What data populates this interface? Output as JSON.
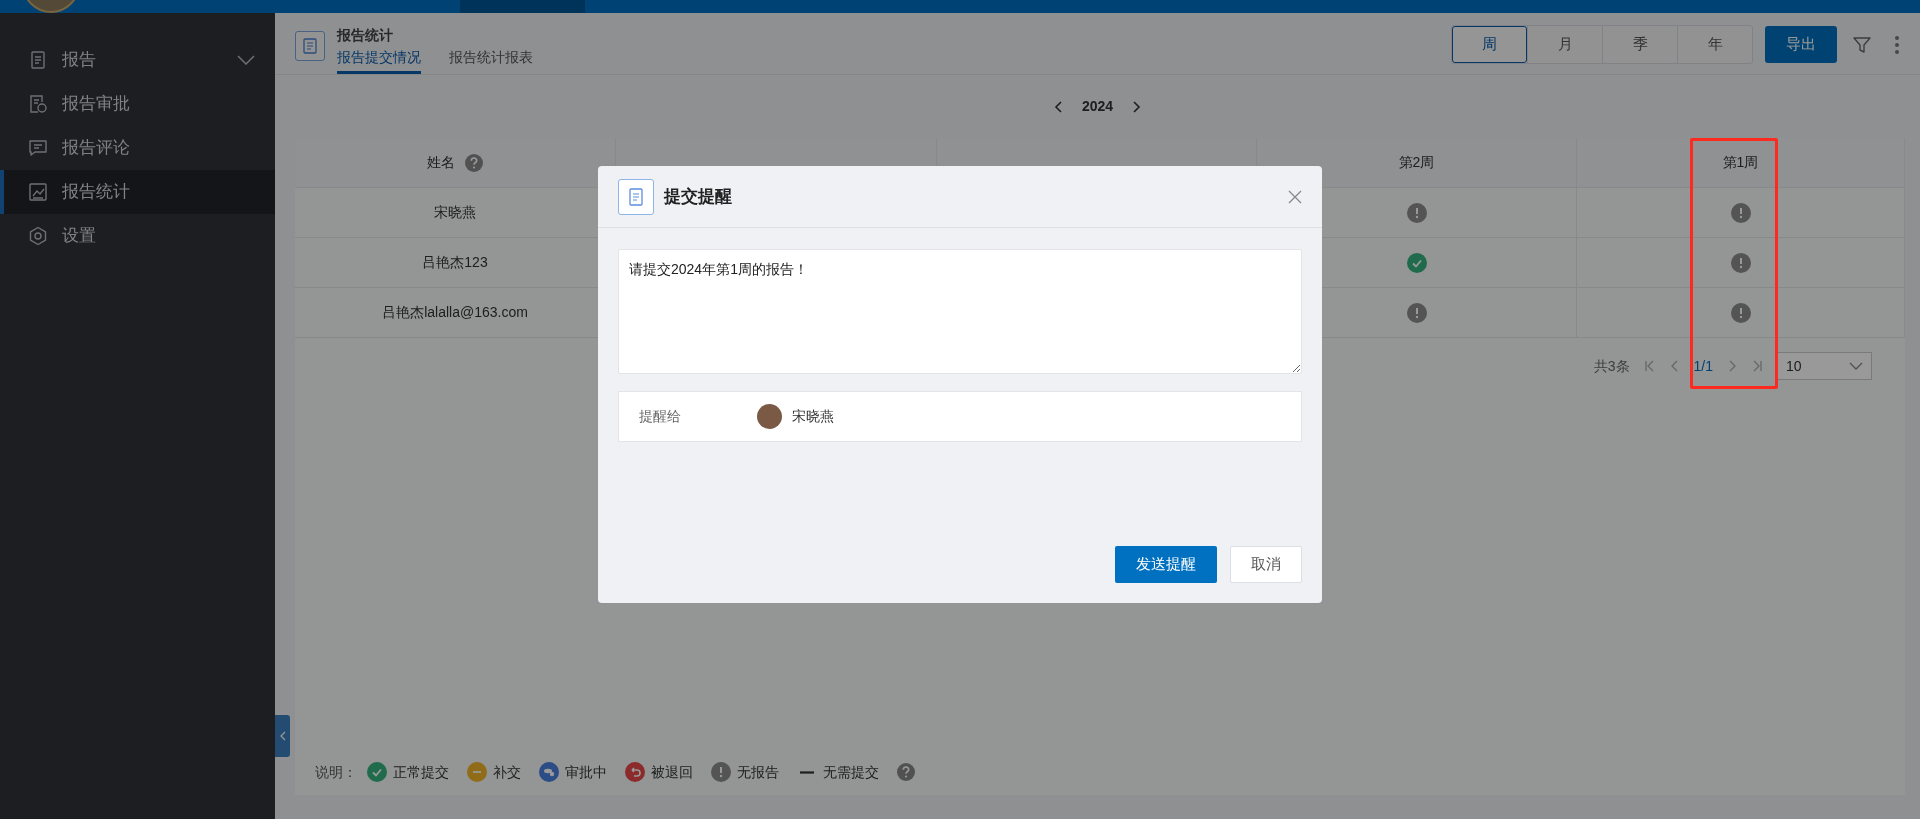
{
  "sidebar": {
    "items": [
      {
        "label": "报告",
        "kind": "document",
        "selected": false,
        "expanded": false
      },
      {
        "label": "报告审批",
        "kind": "approval",
        "selected": false
      },
      {
        "label": "报告评论",
        "kind": "comment",
        "selected": false
      },
      {
        "label": "报告统计",
        "kind": "chart",
        "selected": true
      },
      {
        "label": "设置",
        "kind": "settings",
        "selected": false
      }
    ]
  },
  "page_header": {
    "title": "报告统计",
    "tabs": [
      {
        "label": "报告提交情况",
        "selected": true
      },
      {
        "label": "报告统计报表",
        "selected": false
      }
    ]
  },
  "period_switch": [
    {
      "label": "周",
      "selected": true
    },
    {
      "label": "月",
      "selected": false
    },
    {
      "label": "季",
      "selected": false
    },
    {
      "label": "年",
      "selected": false
    }
  ],
  "export_button": "导出",
  "year_nav": {
    "year": "2024"
  },
  "table": {
    "name_column": {
      "label": "姓名",
      "help": true
    },
    "week_columns": [
      {
        "label": "第2周"
      },
      {
        "label": "第1周"
      }
    ],
    "rows": [
      {
        "name": "宋晓燕",
        "cells": [
          {
            "kind": "none"
          },
          {
            "kind": "none"
          }
        ]
      },
      {
        "name": "吕艳杰123",
        "cells": [
          {
            "kind": "ok"
          },
          {
            "kind": "none"
          }
        ]
      },
      {
        "name": "吕艳杰lalalla@163.com",
        "cells": [
          {
            "kind": "none"
          },
          {
            "kind": "none"
          }
        ]
      }
    ]
  },
  "pagination": {
    "total": "共3条",
    "page": "1/1",
    "page_size": "10"
  },
  "legend": {
    "label": "说明：",
    "items": [
      {
        "kind": "ok",
        "label": "正常提交"
      },
      {
        "kind": "late",
        "label": "补交"
      },
      {
        "kind": "pending",
        "label": "审批中"
      },
      {
        "kind": "returned",
        "label": "被退回"
      },
      {
        "kind": "none",
        "label": "无报告"
      },
      {
        "kind": "not_required",
        "label": "无需提交"
      }
    ],
    "help": true
  },
  "modal": {
    "title": "提交提醒",
    "message": "请提交2024年第1周的报告！",
    "remind_label": "提醒给",
    "recipient": "宋晓燕",
    "send_button": "发送提醒",
    "cancel_button": "取消"
  }
}
